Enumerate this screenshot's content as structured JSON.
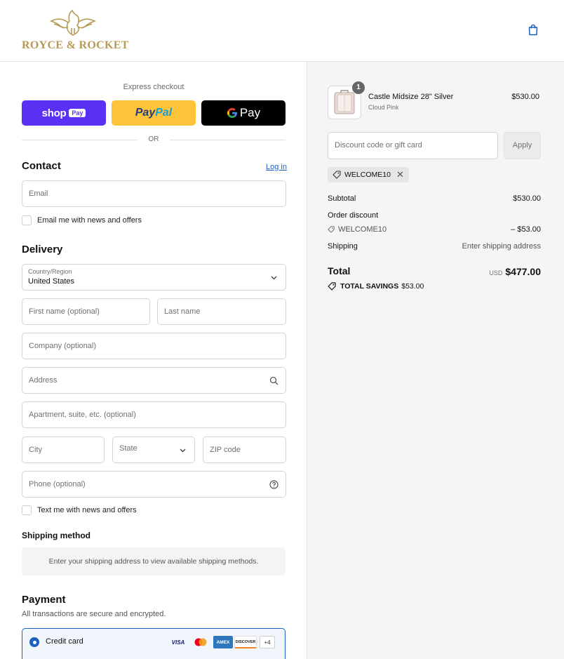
{
  "header": {
    "brand": "ROYCE & ROCKET"
  },
  "express": {
    "label": "Express checkout",
    "shop_pay": "shop",
    "shop_badge": "Pay",
    "paypal_a": "Pay",
    "paypal_b": "Pal",
    "gpay": "Pay",
    "or": "OR"
  },
  "contact": {
    "title": "Contact",
    "login": "Log in",
    "email_placeholder": "Email",
    "newsletter": "Email me with news and offers"
  },
  "delivery": {
    "title": "Delivery",
    "country_label": "Country/Region",
    "country_value": "United States",
    "first_name": "First name (optional)",
    "last_name": "Last name",
    "company": "Company (optional)",
    "address": "Address",
    "apartment": "Apartment, suite, etc. (optional)",
    "city": "City",
    "state": "State",
    "zip": "ZIP code",
    "phone": "Phone (optional)",
    "sms": "Text me with news and offers"
  },
  "shipping": {
    "title": "Shipping method",
    "message": "Enter your shipping address to view available shipping methods."
  },
  "payment": {
    "title": "Payment",
    "subtitle": "All transactions are secure and encrypted.",
    "method": "Credit card",
    "cards": [
      "VISA",
      "MC",
      "AMEX",
      "DISCOVER"
    ],
    "more": "+4"
  },
  "order": {
    "item": {
      "qty": "1",
      "name": "Castle Midsize 28\" Silver",
      "variant": "Cloud Pink",
      "price": "$530.00"
    },
    "discount_placeholder": "Discount code or gift card",
    "apply": "Apply",
    "applied_code": "WELCOME10",
    "subtotal_label": "Subtotal",
    "subtotal": "$530.00",
    "order_discount_label": "Order discount",
    "discount_code": "WELCOME10",
    "discount_amount": "– $53.00",
    "shipping_label": "Shipping",
    "shipping_value": "Enter shipping address",
    "total_label": "Total",
    "currency": "USD",
    "total": "$477.00",
    "savings_label": "TOTAL SAVINGS",
    "savings": "$53.00"
  },
  "colors": {
    "brand_gold": "#b69a55",
    "link_blue": "#1f5fbf",
    "shop_purple": "#5a31f4",
    "paypal_yellow": "#ffc439"
  }
}
